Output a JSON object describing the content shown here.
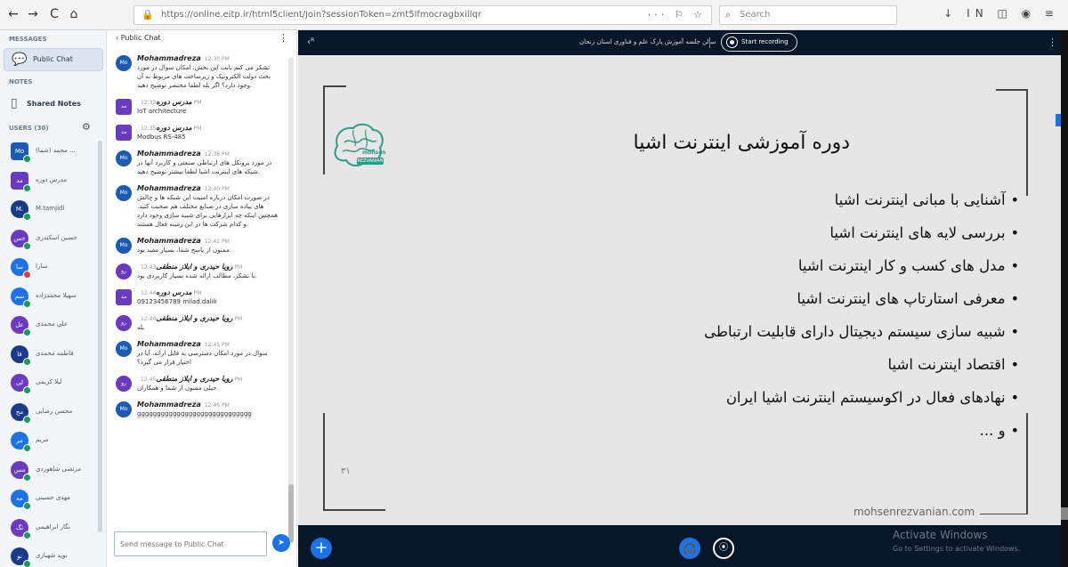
{
  "browser": {
    "back": "←",
    "forward": "→",
    "reload": "C",
    "home": "⌂",
    "url": "https://online.eitp.ir/html5client/join?sessionToken=zmt5lfmocragbxillqr",
    "url_actions": "··· ⚐ ☆",
    "search_placeholder": "Search",
    "toolbar_icons": "↓ IN ◫ ◉ ≡"
  },
  "userlist": {
    "messages_label": "MESSAGES",
    "public_chat_label": "Public Chat",
    "notes_label": "NOTES",
    "shared_notes_label": "Shared Notes",
    "users_label": "USERS (30)",
    "users": [
      {
        "initials": "Mo",
        "name": "(شما) محمد ...",
        "shape": "sq",
        "color": "#1a5bb5",
        "status": "green"
      },
      {
        "initials": "مد",
        "name": "مدرس دوره",
        "shape": "sq",
        "color": "#6a3bc0",
        "status": "green"
      },
      {
        "initials": "M.",
        "name": "M.tamjidi",
        "shape": "round",
        "color": "#1a3a8a",
        "status": "green"
      },
      {
        "initials": "حس",
        "name": "حسین اسکندری",
        "shape": "round",
        "color": "#6a3bc0",
        "status": "green"
      },
      {
        "initials": "سا",
        "name": "سارا",
        "shape": "round",
        "color": "#1a73e8",
        "status": "red"
      },
      {
        "initials": "سم",
        "name": "سهیلا محمدزاده",
        "shape": "round",
        "color": "#1a73e8",
        "status": "green"
      },
      {
        "initials": "عل",
        "name": "علی محمدی",
        "shape": "round",
        "color": "#6a3bc0",
        "status": "green"
      },
      {
        "initials": "فا",
        "name": "فاطمه محمدی",
        "shape": "round",
        "color": "#1a3a8a",
        "status": "green"
      },
      {
        "initials": "لی",
        "name": "لیلا کریمی",
        "shape": "round",
        "color": "#6a3bc0",
        "status": "green"
      },
      {
        "initials": "مح",
        "name": "محسن رضایی",
        "shape": "round",
        "color": "#1a3a8a",
        "status": "green"
      },
      {
        "initials": "مر",
        "name": "مریم",
        "shape": "round",
        "color": "#1a73e8",
        "status": "green"
      },
      {
        "initials": "مس",
        "name": "مرتضی شاهوردی",
        "shape": "round",
        "color": "#6a3bc0",
        "status": "green"
      },
      {
        "initials": "مه",
        "name": "مهدی حسینی",
        "shape": "round",
        "color": "#1a73e8",
        "status": "green"
      },
      {
        "initials": "نگ",
        "name": "نگار ابراهیمی",
        "shape": "round",
        "color": "#6a3bc0",
        "status": "green"
      },
      {
        "initials": "نو",
        "name": "نوید شهبازی",
        "shape": "round",
        "color": "#1a3a8a",
        "status": "green"
      }
    ]
  },
  "chat": {
    "back_label": "‹ Public Chat",
    "menu": "⋮",
    "input_placeholder": "Send message to Public Chat",
    "send": "➤",
    "messages": [
      {
        "initials": "Mo",
        "avatar": "round",
        "author": "Mohammadreza",
        "time": "12:30 PM",
        "text": "تشکر می کنم بابت این بخش. امکان سوال در مورد بحث دولت الکترونیک و زیرساخت های مربوط به آن وجود دارد؟ اگر بله لطفا مختصر توضیح دهید."
      },
      {
        "initials": "مد",
        "avatar": "sq",
        "author": "مدرس دوره",
        "time": "12:33 PM",
        "text": "IoT architecture"
      },
      {
        "initials": "مد",
        "avatar": "sq",
        "author": "مدرس دوره",
        "time": "12:35 PM",
        "text": "Modbus RS-485"
      },
      {
        "initials": "Mo",
        "avatar": "round",
        "author": "Mohammadreza",
        "time": "12:38 PM",
        "text": "در مورد پروتکل های ارتباطی صنعتی و کاربرد آنها در شبکه های اینترنت اشیا لطفا بیشتر توضیح دهید."
      },
      {
        "initials": "Mo",
        "avatar": "round",
        "author": "Mohammadreza",
        "time": "12:40 PM",
        "text": "در صورت امکان درباره امنیت این شبکه ها و چالش های پیاده سازی در صنایع مختلف هم صحبت کنید. همچنین اینکه چه ابزارهایی برای شبیه سازی وجود دارد و کدام شرکت ها در این زمینه فعال هستند."
      },
      {
        "initials": "Mo",
        "avatar": "round",
        "author": "Mohammadreza",
        "time": "12:42 PM",
        "text": "ممنون از پاسخ شما، بسیار مفید بود."
      },
      {
        "initials": "رو",
        "avatar": "purple",
        "author": "رویا حیدری و ایلاز منطقی",
        "time": "12:43 PM",
        "text": "با تشکر، مطالب ارائه شده بسیار کاربردی بود."
      },
      {
        "initials": "مد",
        "avatar": "sq",
        "author": "مدرس دوره",
        "time": "12:44 PM",
        "text": "09123456789 milad.dalili"
      },
      {
        "initials": "رو",
        "avatar": "purple",
        "author": "رویا حیدری و ایلاز منطقی",
        "time": "12:44 PM",
        "text": "بله"
      },
      {
        "initials": "Mo",
        "avatar": "round",
        "author": "Mohammadreza",
        "time": "12:45 PM",
        "text": "سوال در مورد امکان دسترسی به فایل ارائه، آیا در اختیار قرار می گیرد؟"
      },
      {
        "initials": "رو",
        "avatar": "purple",
        "author": "رویا حیدری و ایلاز منطقی",
        "time": "12:45 PM",
        "text": "خیلی ممنون از شما و همکاران"
      },
      {
        "initials": "Mo",
        "avatar": "round",
        "author": "Mohammadreza",
        "time": "12:46 PM",
        "text": "ggggggggggggggggggggggggggggg"
      }
    ]
  },
  "presentation": {
    "user_toggle": "‹ᴿ",
    "session_title": "سالن جلسه آموزش پارک علم و فناوری استان زنجان",
    "record_label": "Start recording",
    "menu": "⋮",
    "slide": {
      "logo_text": "mohsen",
      "logo_tag": "REZVANIAN",
      "title": "دوره آموزشی اینترنت اشیا",
      "bullets": [
        "آشنایی با مبانی اینترنت اشیا",
        "بررسی لایه های اینترنت اشیا",
        "مدل های کسب و کار اینترنت اشیا",
        "معرفی استارتاپ های اینترنت اشیا",
        "شبیه سازی سیستم دیجیتال دارای قابلیت ارتباطی",
        "اقتصاد اینترنت اشیا",
        "نهادهای فعال در اکوسیستم اینترنت اشیا ایران",
        "و ..."
      ],
      "page_number": "۳۱",
      "site": "mohsenrezvanian.com"
    },
    "plus": "+",
    "audio": "🎧",
    "screen": "⦿",
    "watermark_title": "Activate Windows",
    "watermark_sub": "Go to Settings to activate Windows."
  }
}
